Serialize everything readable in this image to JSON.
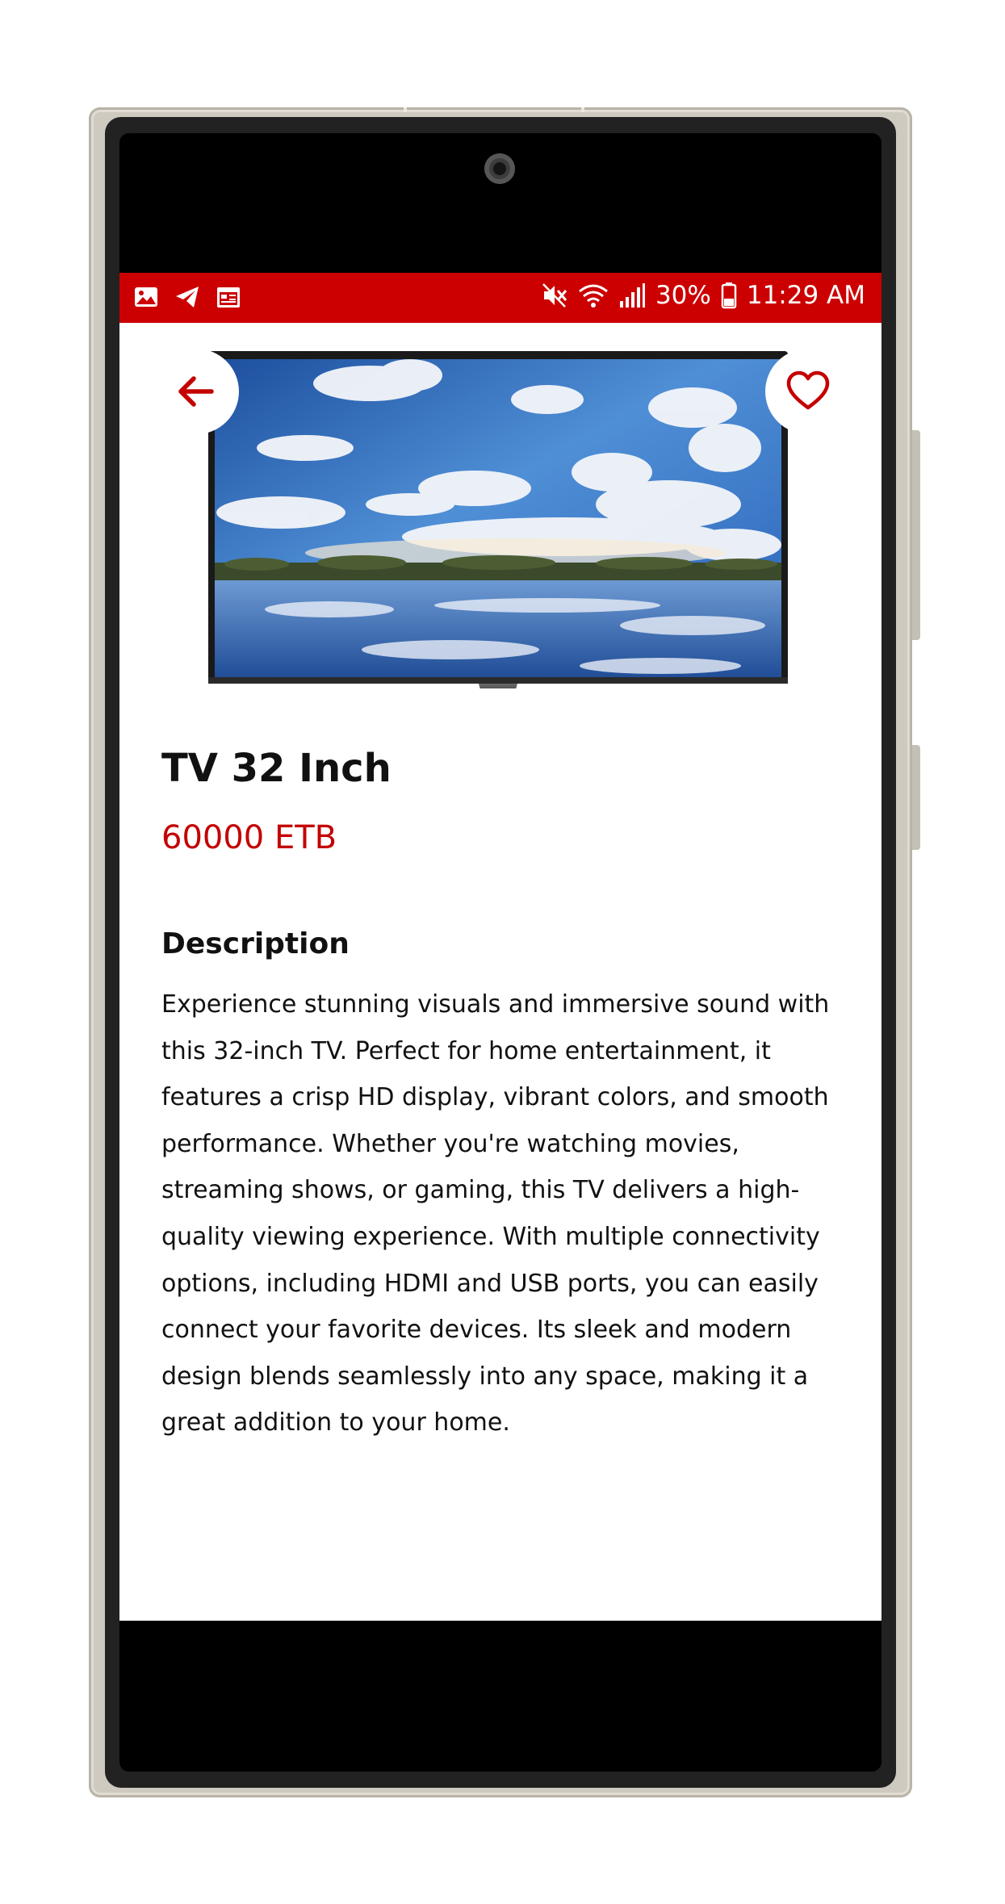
{
  "status_bar": {
    "left_icons": [
      "gallery-icon",
      "telegram-icon",
      "calendar-icon"
    ],
    "right_icons": [
      "mute-icon",
      "wifi-icon",
      "signal-icon",
      "battery-icon"
    ],
    "battery": "30%",
    "time": "11:29 AM",
    "color": "#cc0000"
  },
  "header": {
    "back_icon": "arrow-left-icon",
    "favorite_icon": "heart-outline-icon",
    "icon_color": "#c40000"
  },
  "product": {
    "title": "TV 32 Inch",
    "price": "60000 ETB",
    "description_heading": "Description",
    "description": "Experience stunning visuals and immersive sound with this 32-inch TV. Perfect for home entertainment, it features a crisp HD display, vibrant colors, and smooth performance. Whether you're watching movies, streaming shows, or gaming, this TV delivers a high-quality viewing experience. With multiple connectivity options, including HDMI and USB ports, you can easily connect your favorite devices. Its sleek and modern design blends seamlessly into any space, making it a great addition to your home."
  },
  "colors": {
    "accent": "#c40000",
    "text": "#111111",
    "background": "#ffffff"
  }
}
